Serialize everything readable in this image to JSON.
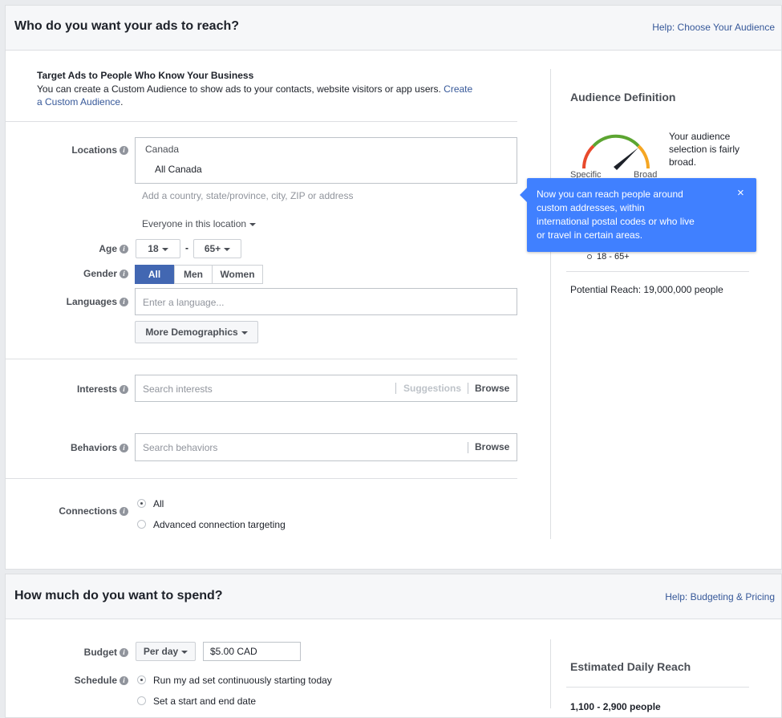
{
  "audience_panel": {
    "title": "Who do you want your ads to reach?",
    "help_link": "Help: Choose Your Audience",
    "custom_audience": {
      "heading": "Target Ads to People Who Know Your Business",
      "text": "You can create a Custom Audience to show ads to your contacts, website visitors or app users.",
      "link_part1": "Create",
      "link_part2": "a Custom Audience",
      "after_link": "."
    },
    "locations": {
      "label": "Locations",
      "country": "Canada",
      "region": "All Canada",
      "placeholder": "Add a country, state/province, city, ZIP or address",
      "scope": "Everyone in this location"
    },
    "age": {
      "label": "Age",
      "min": "18",
      "separator": "-",
      "max": "65+"
    },
    "gender": {
      "label": "Gender",
      "options": [
        "All",
        "Men",
        "Women"
      ],
      "selected": "All"
    },
    "languages": {
      "label": "Languages",
      "placeholder": "Enter a language..."
    },
    "more_demographics": "More Demographics",
    "interests": {
      "label": "Interests",
      "placeholder": "Search interests",
      "suggestions": "Suggestions",
      "browse": "Browse"
    },
    "behaviors": {
      "label": "Behaviors",
      "placeholder": "Search behaviors",
      "browse": "Browse"
    },
    "connections": {
      "label": "Connections",
      "options": [
        "All",
        "Advanced connection targeting"
      ],
      "selected": "All"
    }
  },
  "audience_definition": {
    "title": "Audience Definition",
    "gauge_text": [
      "Your audience",
      "selection is fairly",
      "broad."
    ],
    "gauge_left": "Specific",
    "gauge_right": "Broad",
    "age_item": "18 - 65+",
    "potential_reach": "Potential Reach: 19,000,000 people"
  },
  "tooltip": {
    "text": [
      "Now you can reach people around",
      "custom addresses, within",
      "international postal codes or who live",
      "or travel in certain areas."
    ],
    "close": "×"
  },
  "budget_panel": {
    "title": "How much do you want to spend?",
    "help_link": "Help: Budgeting & Pricing",
    "budget": {
      "label": "Budget",
      "period": "Per day",
      "amount": "$5.00 CAD"
    },
    "schedule": {
      "label": "Schedule",
      "options": [
        "Run my ad set continuously starting today",
        "Set a start and end date"
      ],
      "selected": "Run my ad set continuously starting today"
    },
    "estimated": {
      "title": "Estimated Daily Reach",
      "value": "1,100 - 2,900 people"
    }
  },
  "colors": {
    "accent": "#4267b2",
    "tooltip": "#4080ff",
    "link": "#365899"
  }
}
